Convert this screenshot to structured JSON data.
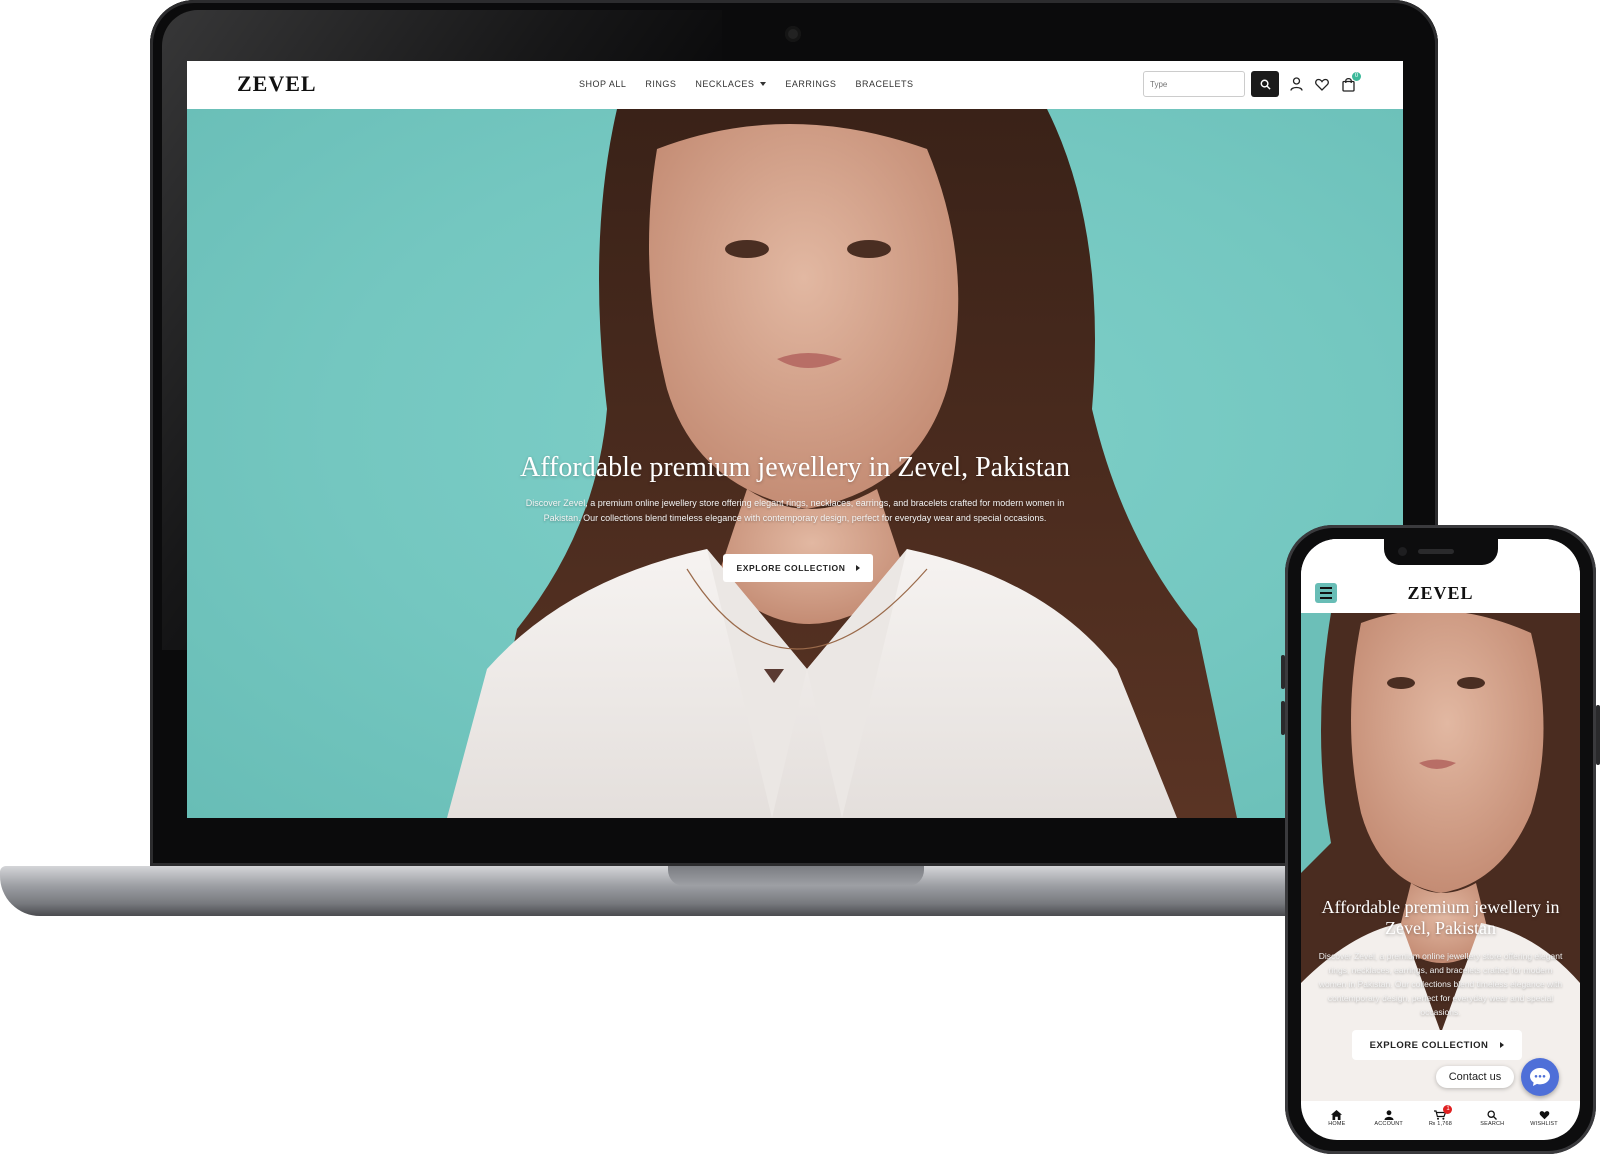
{
  "desktop": {
    "logo": "ZEVEL",
    "nav": [
      {
        "label": "SHOP ALL"
      },
      {
        "label": "RINGS"
      },
      {
        "label": "NECKLACES",
        "has_dropdown": true
      },
      {
        "label": "EARRINGS"
      },
      {
        "label": "BRACELETS"
      }
    ],
    "search": {
      "placeholder": "Type"
    },
    "header_icons": [
      "search-icon",
      "user-icon",
      "heart-icon",
      "shopping-bag-icon"
    ],
    "cart_count": "0",
    "hero": {
      "title": "Affordable premium jewellery in Zevel, Pakistan",
      "description": "Discover Zevel, a premium online jewellery store offering elegant rings, necklaces, earrings, and bracelets crafted for modern women in Pakistan. Our collections blend timeless elegance with contemporary design, perfect for everyday wear and special occasions.",
      "button_label": "EXPLORE COLLECTION",
      "background_color": "#74c7c0"
    }
  },
  "mobile": {
    "logo": "ZEVEL",
    "menu_icon": "hamburger-icon",
    "hero": {
      "title": "Affordable premium jewellery in Zevel, Pakistan",
      "description": "Discover Zevel, a premium online jewellery store offering elegant rings, necklaces, earrings, and bracelets crafted for modern women in Pakistan. Our collections blend timeless elegance with contemporary design, perfect for everyday wear and special occasions.",
      "button_label": "EXPLORE COLLECTION"
    },
    "contact_label": "Contact us",
    "bottom_nav": [
      {
        "label": "HOME",
        "icon": "home-icon"
      },
      {
        "label": "ACCOUNT",
        "icon": "user-icon"
      },
      {
        "label": "₨ 1,768",
        "icon": "cart-icon",
        "badge": "1"
      },
      {
        "label": "SEARCH",
        "icon": "search-icon"
      },
      {
        "label": "WISHLIST",
        "icon": "heart-icon"
      }
    ]
  },
  "colors": {
    "accent_teal": "#74c7c0",
    "cart_badge": "#3cb99a",
    "contact_fab": "#4e6fd8",
    "mobile_badge": "#e02020"
  }
}
